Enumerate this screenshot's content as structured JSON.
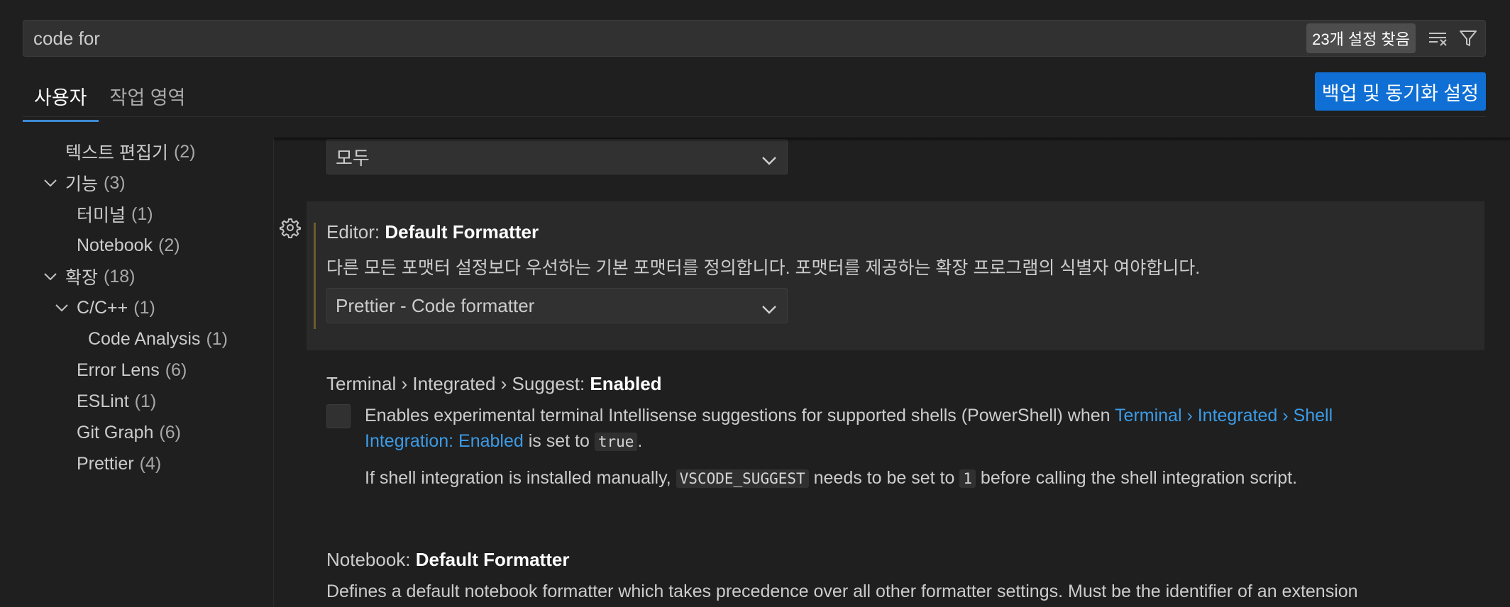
{
  "search": {
    "value": "code for",
    "result_badge": "23개 설정 찾음",
    "clear_filter_icon": "clear-filter-icon",
    "filter_icon": "filter-icon"
  },
  "tabs": [
    {
      "label": "사용자",
      "active": true
    },
    {
      "label": "작업 영역",
      "active": false
    }
  ],
  "sync_button_label": "백업 및 동기화 설정",
  "toc": [
    {
      "label": "텍스트 편집기",
      "count": "(2)",
      "expanded": null
    },
    {
      "label": "기능",
      "count": "(3)",
      "expanded": true
    },
    {
      "label": "터미널",
      "count": "(1)",
      "expanded": null
    },
    {
      "label": "Notebook",
      "count": "(2)",
      "expanded": null
    },
    {
      "label": "확장",
      "count": "(18)",
      "expanded": true
    },
    {
      "label": "C/C++",
      "count": "(1)",
      "expanded": true
    },
    {
      "label": "Code Analysis",
      "count": "(1)",
      "expanded": null
    },
    {
      "label": "Error Lens",
      "count": "(6)",
      "expanded": null
    },
    {
      "label": "ESLint",
      "count": "(1)",
      "expanded": null
    },
    {
      "label": "Git Graph",
      "count": "(6)",
      "expanded": null
    },
    {
      "label": "Prettier",
      "count": "(4)",
      "expanded": null
    }
  ],
  "settings": {
    "top_dropdown_value": "모두",
    "default_formatter": {
      "category": "Editor: ",
      "name": "Default Formatter",
      "description": "다른 모든 포맷터 설정보다 우선하는 기본 포맷터를 정의합니다. 포맷터를 제공하는 확장 프로그램의 식별자 여야합니다.",
      "value": "Prettier - Code formatter"
    },
    "terminal_suggest": {
      "category": "Terminal › Integrated › Suggest: ",
      "name": "Enabled",
      "desc_part1": "Enables experimental terminal Intellisense suggestions for supported shells (PowerShell) when ",
      "desc_link1": "Terminal › Integrated › Shell",
      "desc_link2": "Integration: Enabled",
      "desc_part2": " is set to ",
      "desc_code": "true",
      "desc_part3": ".",
      "note_part1": "If shell integration is installed manually, ",
      "note_code1": "VSCODE_SUGGEST",
      "note_part2": " needs to be set to ",
      "note_code2": "1",
      "note_part3": " before calling the shell integration script.",
      "checked": false
    },
    "notebook_formatter": {
      "category": "Notebook: ",
      "name": "Default Formatter",
      "description": "Defines a default notebook formatter which takes precedence over all other formatter settings. Must be the identifier of an extension"
    }
  },
  "colors": {
    "background": "#1f1f1f",
    "accent": "#0f6fd4",
    "link": "#3c9be6"
  }
}
